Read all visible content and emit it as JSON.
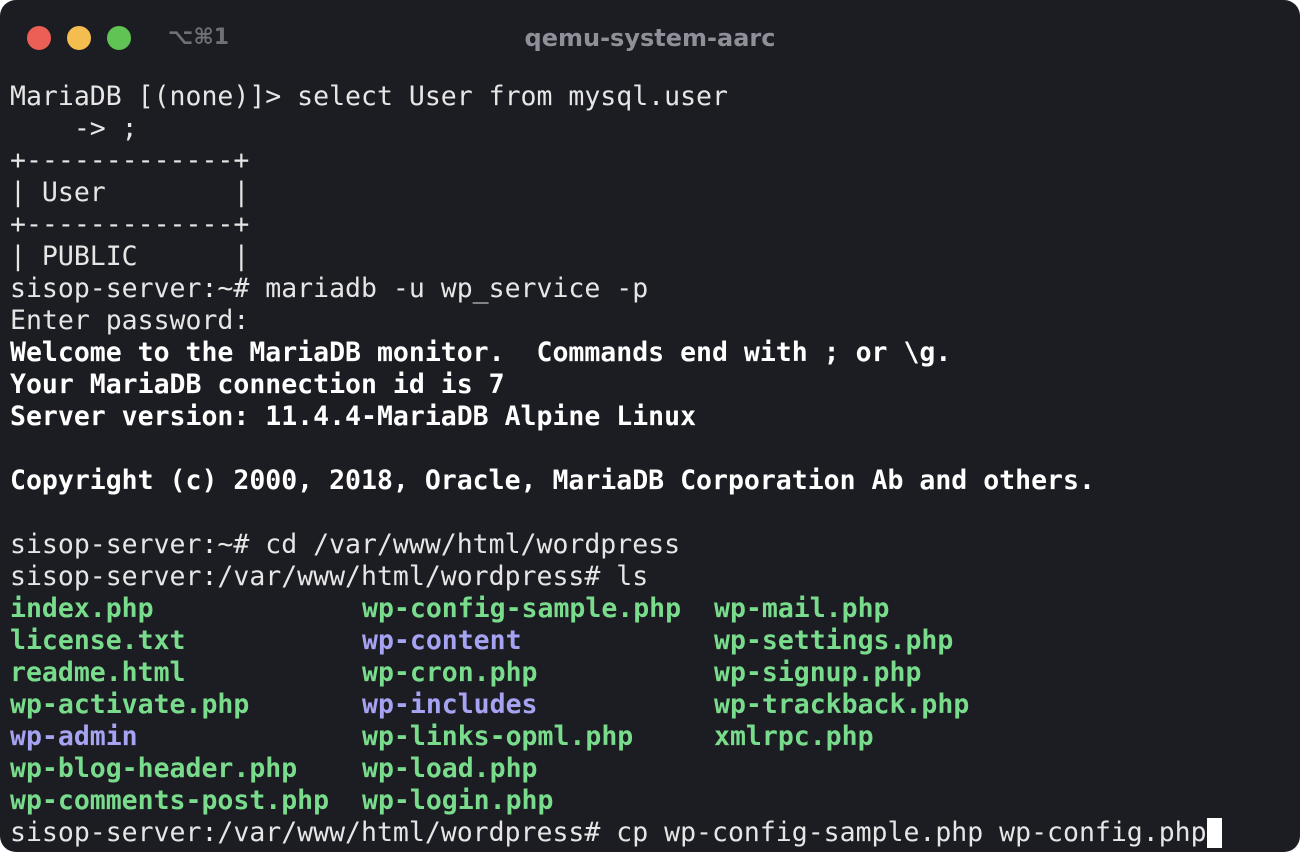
{
  "window": {
    "shortcut": "⌥⌘1",
    "title": "qemu-system-aarc"
  },
  "terminal": {
    "lines": [
      {
        "text": "MariaDB [(none)]> select User from mysql.user",
        "bold": false
      },
      {
        "text": "    -> ;",
        "bold": false
      },
      {
        "text": "+-------------+",
        "bold": false
      },
      {
        "text": "| User        |",
        "bold": false
      },
      {
        "text": "+-------------+",
        "bold": false
      },
      {
        "text": "| PUBLIC      |",
        "bold": false
      },
      {
        "text": "sisop-server:~# mariadb -u wp_service -p",
        "bold": false
      },
      {
        "text": "Enter password:",
        "bold": false
      },
      {
        "text": "Welcome to the MariaDB monitor.  Commands end with ; or \\g.",
        "bold": true
      },
      {
        "text": "Your MariaDB connection id is 7",
        "bold": true
      },
      {
        "text": "Server version: 11.4.4-MariaDB Alpine Linux",
        "bold": true
      },
      {
        "text": "",
        "bold": false
      },
      {
        "text": "Copyright (c) 2000, 2018, Oracle, MariaDB Corporation Ab and others.",
        "bold": true
      },
      {
        "text": "",
        "bold": false
      },
      {
        "text": "sisop-server:~# cd /var/www/html/wordpress",
        "bold": false
      },
      {
        "text": "sisop-server:/var/www/html/wordpress# ls",
        "bold": false
      }
    ],
    "ls_rows": [
      [
        {
          "name": "index.php",
          "type": "file"
        },
        {
          "name": "wp-config-sample.php",
          "type": "file"
        },
        {
          "name": "wp-mail.php",
          "type": "file"
        }
      ],
      [
        {
          "name": "license.txt",
          "type": "file"
        },
        {
          "name": "wp-content",
          "type": "dir"
        },
        {
          "name": "wp-settings.php",
          "type": "file"
        }
      ],
      [
        {
          "name": "readme.html",
          "type": "file"
        },
        {
          "name": "wp-cron.php",
          "type": "file"
        },
        {
          "name": "wp-signup.php",
          "type": "file"
        }
      ],
      [
        {
          "name": "wp-activate.php",
          "type": "file"
        },
        {
          "name": "wp-includes",
          "type": "dir"
        },
        {
          "name": "wp-trackback.php",
          "type": "file"
        }
      ],
      [
        {
          "name": "wp-admin",
          "type": "dir"
        },
        {
          "name": "wp-links-opml.php",
          "type": "file"
        },
        {
          "name": "xmlrpc.php",
          "type": "file"
        }
      ],
      [
        {
          "name": "wp-blog-header.php",
          "type": "file"
        },
        {
          "name": "wp-load.php",
          "type": "file"
        },
        null
      ],
      [
        {
          "name": "wp-comments-post.php",
          "type": "file"
        },
        {
          "name": "wp-login.php",
          "type": "file"
        },
        null
      ]
    ],
    "prompt_line": "sisop-server:/var/www/html/wordpress# cp wp-config-sample.php wp-config.php"
  },
  "colors": {
    "background": "#1c1d22",
    "text": "#e6e6e6",
    "file": "#78dc8c",
    "directory": "#a5a3f2",
    "close": "#ec5f57",
    "minimize": "#f4bd4f",
    "maximize": "#5fc453"
  }
}
